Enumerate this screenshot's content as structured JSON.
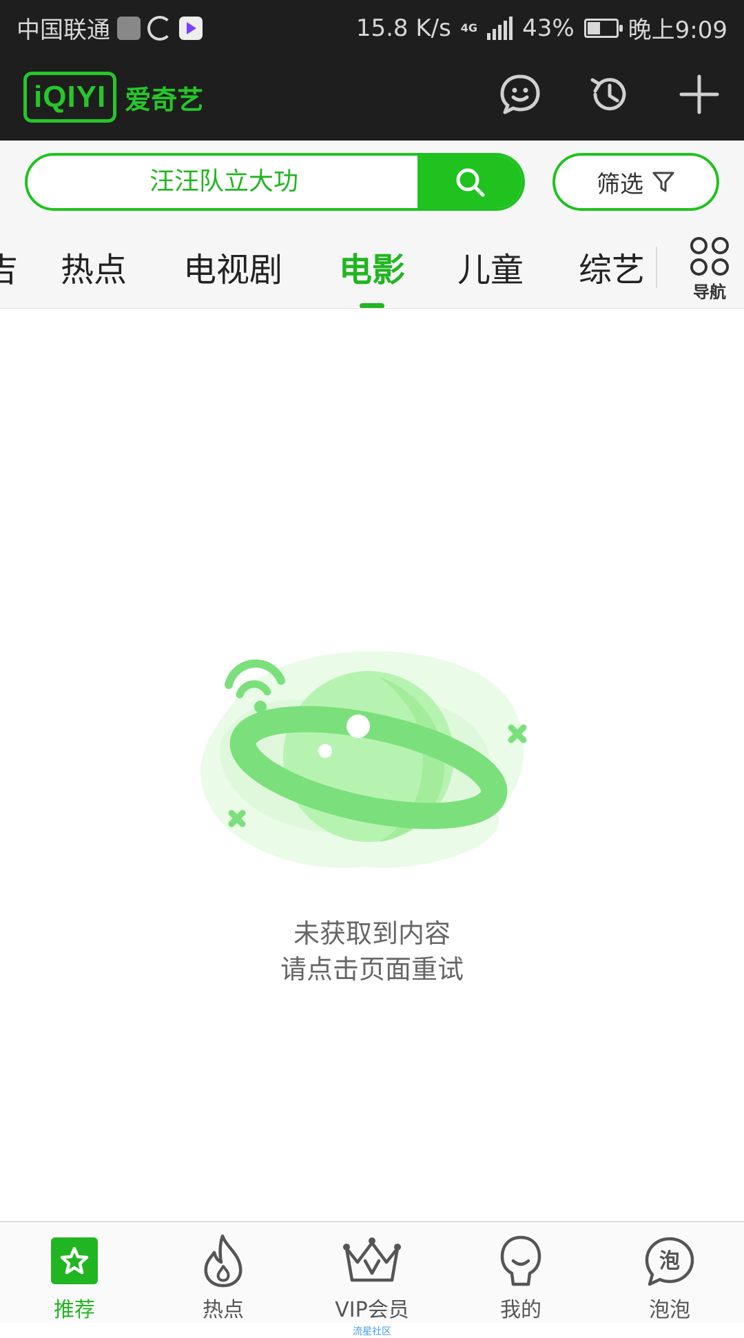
{
  "status_bar": {
    "carrier": "中国联通",
    "speed": "15.8 K/s",
    "network": "4G",
    "battery": "43%",
    "time": "晚上9:09"
  },
  "header": {
    "logo_mark": "iQIYI",
    "app_name": "爱奇艺",
    "icons": [
      "chat-icon",
      "history-icon",
      "plus-icon"
    ]
  },
  "search": {
    "query": "汪汪队立大功",
    "filter_label": "筛选"
  },
  "tabs": {
    "items": [
      "吉",
      "热点",
      "电视剧",
      "电影",
      "儿童",
      "综艺"
    ],
    "active": "电影",
    "nav_label": "导航"
  },
  "empty_state": {
    "line1": "未获取到内容",
    "line2": "请点击页面重试"
  },
  "bottom_nav": {
    "items": [
      {
        "label": "推荐",
        "icon": "star-icon",
        "active": true
      },
      {
        "label": "热点",
        "icon": "flame-icon",
        "active": false
      },
      {
        "label": "VIP会员",
        "icon": "crown-icon",
        "active": false,
        "sublabel": "流星社区"
      },
      {
        "label": "我的",
        "icon": "profile-icon",
        "active": false
      },
      {
        "label": "泡泡",
        "icon": "bubble-icon",
        "active": false
      }
    ]
  },
  "colors": {
    "brand_green": "#22b522",
    "header_bg": "#1e1e1e",
    "illustration_green": "#7be07b"
  }
}
